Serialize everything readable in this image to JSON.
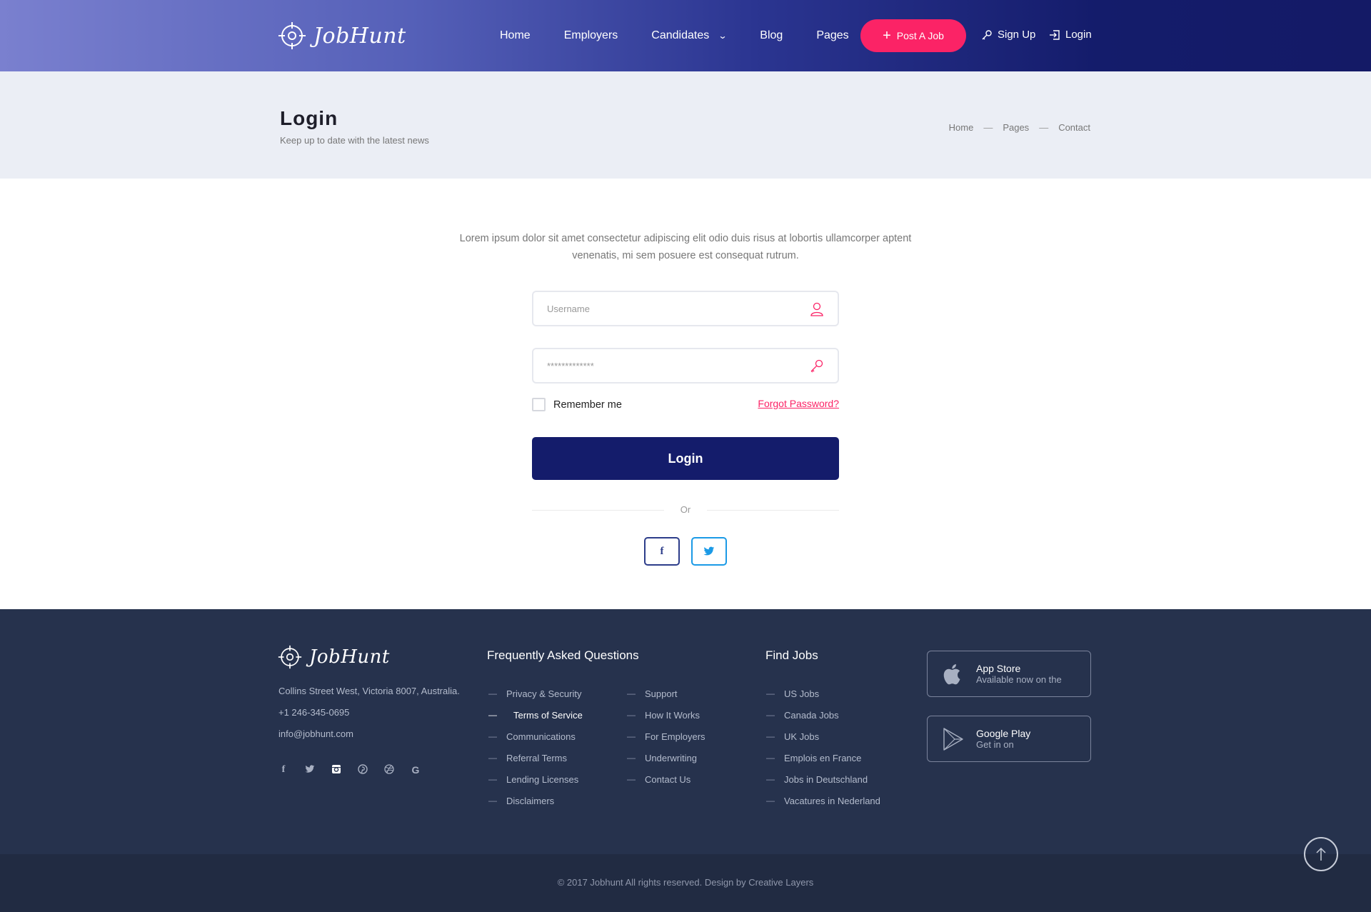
{
  "header": {
    "logo_text": "JobHunt",
    "nav": [
      "Home",
      "Employers",
      "Candidates",
      "Blog",
      "Pages"
    ],
    "post_job_label": "Post A Job",
    "signup_label": "Sign Up",
    "login_label": "Login"
  },
  "banner": {
    "title": "Login",
    "subtitle": "Keep up to date with the latest news",
    "breadcrumbs": [
      "Home",
      "Pages",
      "Contact"
    ]
  },
  "form": {
    "intro": "Lorem ipsum dolor sit amet consectetur adipiscing elit odio duis risus at lobortis ullamcorper aptent venenatis, mi sem posuere est consequat rutrum.",
    "username_placeholder": "Username",
    "password_value": "*************",
    "remember_label": "Remember me",
    "forgot_label": "Forgot Password?",
    "submit_label": "Login",
    "or_label": "Or",
    "social_facebook": "f",
    "social_twitter": "t"
  },
  "footer": {
    "logo_text": "JobHunt",
    "address": "Collins Street West, Victoria 8007, Australia.",
    "phone": "+1 246-345-0695",
    "email": "info@jobhunt.com",
    "social_icons": [
      "facebook-icon",
      "twitter-icon",
      "instagram-icon",
      "pinterest-icon",
      "dribbble-icon",
      "google-icon"
    ],
    "faq_heading": "Frequently Asked Questions",
    "faq_col1": [
      "Privacy & Security",
      "Terms of Service",
      "Communications",
      "Referral Terms",
      "Lending Licenses",
      "Disclaimers"
    ],
    "faq_col2": [
      "Support",
      "How It Works",
      "For Employers",
      "Underwriting",
      "Contact Us"
    ],
    "jobs_heading": "Find Jobs",
    "jobs": [
      "US Jobs",
      "Canada Jobs",
      "UK Jobs",
      "Emplois en France",
      "Jobs in Deutschland",
      "Vacatures in Nederland"
    ],
    "app_store_title": "App Store",
    "app_store_sub": "Available now on the",
    "google_play_title": "Google Play",
    "google_play_sub": "Get in on",
    "copyright": "© 2017 Jobhunt All rights reserved. Design by Creative Layers"
  },
  "colors": {
    "accent": "#fb2366",
    "primary": "#141c6b",
    "footer_bg": "#26324d"
  }
}
